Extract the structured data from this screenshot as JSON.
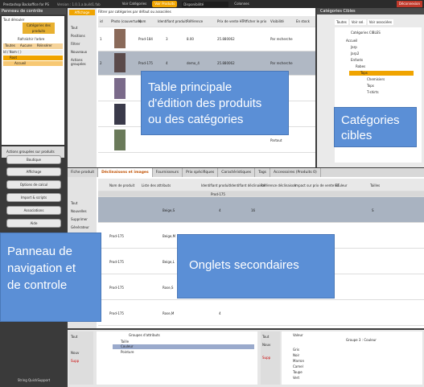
{
  "titlebar": {
    "app_title": "Prestashop Backoffice for PS",
    "version": "Version : 1.0.1.a.build1.fab",
    "tab_categories": "Voir Catégories",
    "tab_products": "Voir Produits",
    "combo_label": "Disponibilité",
    "columns_label": "Colonnes",
    "disconnect_label": "Déconnexion"
  },
  "left_panel": {
    "header": "Panneau de contrôle",
    "tree_items": [
      "Tout dérouler",
      "Catégories des produits",
      "Rafraîchir l'arbre",
      "Toutes",
      "Aucune",
      "Réinsérer",
      "Accueil"
    ],
    "toolbar_label": "Actions groupées sur produits",
    "nav_buttons": [
      "Boutique",
      "Affichage",
      "Options de calcul",
      "Import & scripts",
      "Associations",
      "Aide"
    ],
    "footer": "String QuickSupport"
  },
  "main": {
    "filter_label": "Filtrer par catégories par défaut ou associées",
    "affichage_label": "Affichage",
    "actions": [
      "Tout",
      "Positions",
      "Filtrer",
      "Nouveaux",
      "Actions groupées"
    ],
    "columns": [
      "id",
      "Photo (couverture)",
      "Nom",
      "Identifiant produit",
      "Référence",
      "Prix de vente HT",
      "Afficher le prix",
      "Visibilité",
      "En stock"
    ],
    "rows": [
      {
        "id": "1",
        "name": "Prod-184",
        "ident": "3",
        "ref": "8.00",
        "price": "25.880062",
        "visibility": "Par recherche"
      },
      {
        "id": "2",
        "name": "Prod-175",
        "ident": "4",
        "ref": "demo_4",
        "price": "25.880062",
        "visibility": "Par recherche"
      },
      {
        "id": "3",
        "name": "",
        "ident": "",
        "ref": "",
        "price": "",
        "visibility": "Partout"
      },
      {
        "id": "4",
        "name": "",
        "ident": "",
        "ref": "",
        "price": "",
        "visibility": "Partout"
      },
      {
        "id": "5",
        "name": "",
        "ident": "",
        "ref": "",
        "price": "",
        "visibility": "Partout"
      }
    ],
    "callout_text": [
      "Table principale",
      "d'édition des produits",
      "ou des catégories"
    ]
  },
  "categories_panel": {
    "header": "Catégories Cibles",
    "tabs": [
      "Toutes",
      "Voir sel.",
      "Voir associées"
    ],
    "tree": [
      "Accueil",
      "Accueil",
      "Jarp",
      "Jarp2",
      "Enfants",
      "Robes",
      "Tops",
      "Chemisiers",
      "Tops",
      "T-shirts"
    ],
    "col_header": "Catégories CIBLES",
    "callout_text": [
      "Catégories",
      "cibles"
    ]
  },
  "tabs": [
    "Fiche produit",
    "Déclinaisons et images",
    "Fournisseurs",
    "Prix spécifiques",
    "Caractéristiques",
    "Tags",
    "Accessoires (Produits 0)"
  ],
  "sub_area": {
    "columns": [
      "Nom de produit",
      "Liste des attributs",
      "Identifiant produit",
      "Identifiant déclinaison",
      "Référence déclinaison",
      "Impact sur prix de vente HT",
      "Couleur",
      "Tailles"
    ],
    "row_group": "Prod-175",
    "actions": [
      "Tout",
      "Nouvelles",
      "Supprimer",
      "Générateur",
      "Actions groupées"
    ],
    "rows": [
      {
        "name": "Prod-175",
        "attrs": "Beige,S",
        "ident": "4",
        "decl": "16",
        "color": "",
        "size": "S"
      },
      {
        "name": "Prod-175",
        "attrs": "Beige,M",
        "ident": "4",
        "decl": "",
        "color": "",
        "size": ""
      },
      {
        "name": "Prod-175",
        "attrs": "Beige,L",
        "ident": "4",
        "decl": "",
        "color": "",
        "size": ""
      },
      {
        "name": "Prod-175",
        "attrs": "Rose,S",
        "ident": "4",
        "decl": "",
        "color": "",
        "size": ""
      },
      {
        "name": "Prod-175",
        "attrs": "Rose,M",
        "ident": "4",
        "decl": "",
        "color": "",
        "size": ""
      }
    ],
    "callout_text": [
      "Onglets secondaires"
    ]
  },
  "left_callout_text": [
    "Panneau de",
    "navigation et",
    "de controle"
  ],
  "bottom": {
    "attr_groups_header": "Groupes d'attributs",
    "attr_groups": [
      "Taille",
      "Couleur",
      "Pointure"
    ],
    "left_actions": [
      "Tout",
      "Nouv",
      "Supp"
    ],
    "right_actions": [
      "Tout",
      "Nouv",
      "Supp"
    ],
    "colors_header": "Valeur",
    "colors": [
      "Gris",
      "Noir",
      "Marron",
      "Camel",
      "Taupe",
      "Vert"
    ],
    "selected_group": "Groupe 3 : Couleur"
  }
}
